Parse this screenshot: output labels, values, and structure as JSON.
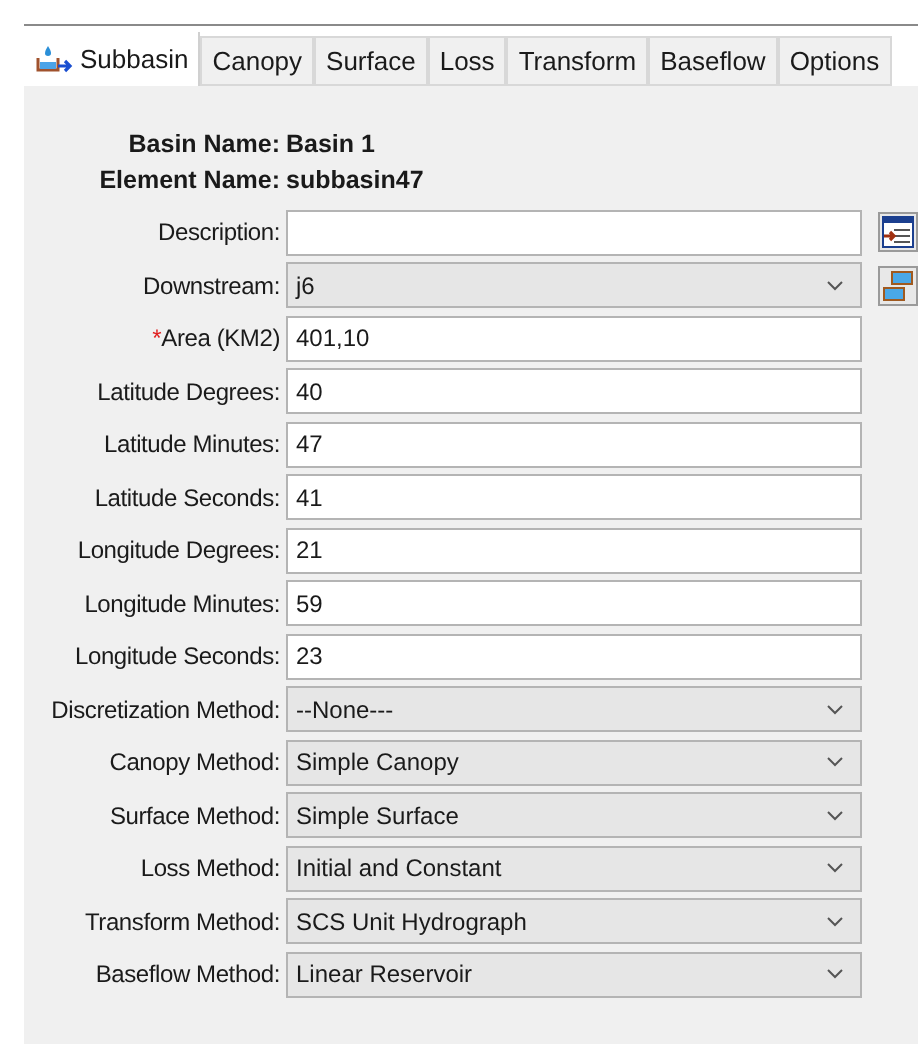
{
  "tabs": [
    {
      "label": "Subbasin",
      "selected": true,
      "kind": "basin"
    },
    {
      "label": "Canopy",
      "selected": false
    },
    {
      "label": "Surface",
      "selected": false
    },
    {
      "label": "Loss",
      "selected": false
    },
    {
      "label": "Transform",
      "selected": false
    },
    {
      "label": "Baseflow",
      "selected": false
    },
    {
      "label": "Options",
      "selected": false
    }
  ],
  "header": [
    {
      "label": "Basin Name:",
      "value": "Basin 1"
    },
    {
      "label": "Element Name:",
      "value": "subbasin47"
    }
  ],
  "fields": [
    {
      "label": "Description:",
      "kind": "text",
      "side": {
        "kind": "notes"
      }
    },
    {
      "label": "Downstream:",
      "kind": "select",
      "value": "j6",
      "side": {
        "kind": "stack"
      }
    },
    {
      "label": "Area (KM2)",
      "required_mark": "*",
      "kind": "text",
      "value": "401,10"
    },
    {
      "label": "Latitude Degrees:",
      "kind": "text",
      "value": "40"
    },
    {
      "label": "Latitude Minutes:",
      "kind": "text",
      "value": "47"
    },
    {
      "label": "Latitude Seconds:",
      "kind": "text",
      "value": "41"
    },
    {
      "label": "Longitude Degrees:",
      "kind": "text",
      "value": "21"
    },
    {
      "label": "Longitude Minutes:",
      "kind": "text",
      "value": "59"
    },
    {
      "label": "Longitude Seconds:",
      "kind": "text",
      "value": "23"
    },
    {
      "label": "Discretization Method:",
      "kind": "select",
      "value": "--None---"
    },
    {
      "label": "Canopy Method:",
      "kind": "select",
      "value": "Simple Canopy"
    },
    {
      "label": "Surface Method:",
      "kind": "select",
      "value": "Simple Surface"
    },
    {
      "label": "Loss Method:",
      "kind": "select",
      "value": "Initial and Constant"
    },
    {
      "label": "Transform Method:",
      "kind": "select",
      "value": "SCS Unit Hydrograph"
    },
    {
      "label": "Baseflow Method:",
      "kind": "select",
      "value": "Linear Reservoir"
    }
  ]
}
